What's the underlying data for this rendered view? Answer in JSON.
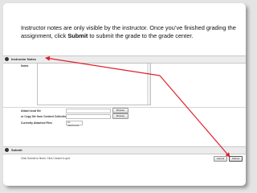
{
  "caption": {
    "part1": "Instructor notes are only visible by the instructor.  Once you’ve finished grading the assignment, click ",
    "bold": "Submit",
    "part2": " to submit the grade to the grade center."
  },
  "sections": {
    "notes": {
      "number": "4",
      "title": "Instructor Notes"
    },
    "submit": {
      "number": "5",
      "title": "Submit"
    }
  },
  "form": {
    "notes_label": "Notes",
    "attach_label": "Attach local file",
    "copy_label": "or  Copy file from Content Collection",
    "attached_label": "Currently Attached Files",
    "attached_select": "No Attachments",
    "browse_label": "Browse",
    "browse2_label": "Browse"
  },
  "submit": {
    "hint": "Click Submit to finish. Click Cancel to quit.",
    "cancel_label": "Cancel",
    "submit_label": "Submit"
  },
  "colors": {
    "arrow": "#e0202a",
    "slide_bg": "#e4e4e4"
  }
}
